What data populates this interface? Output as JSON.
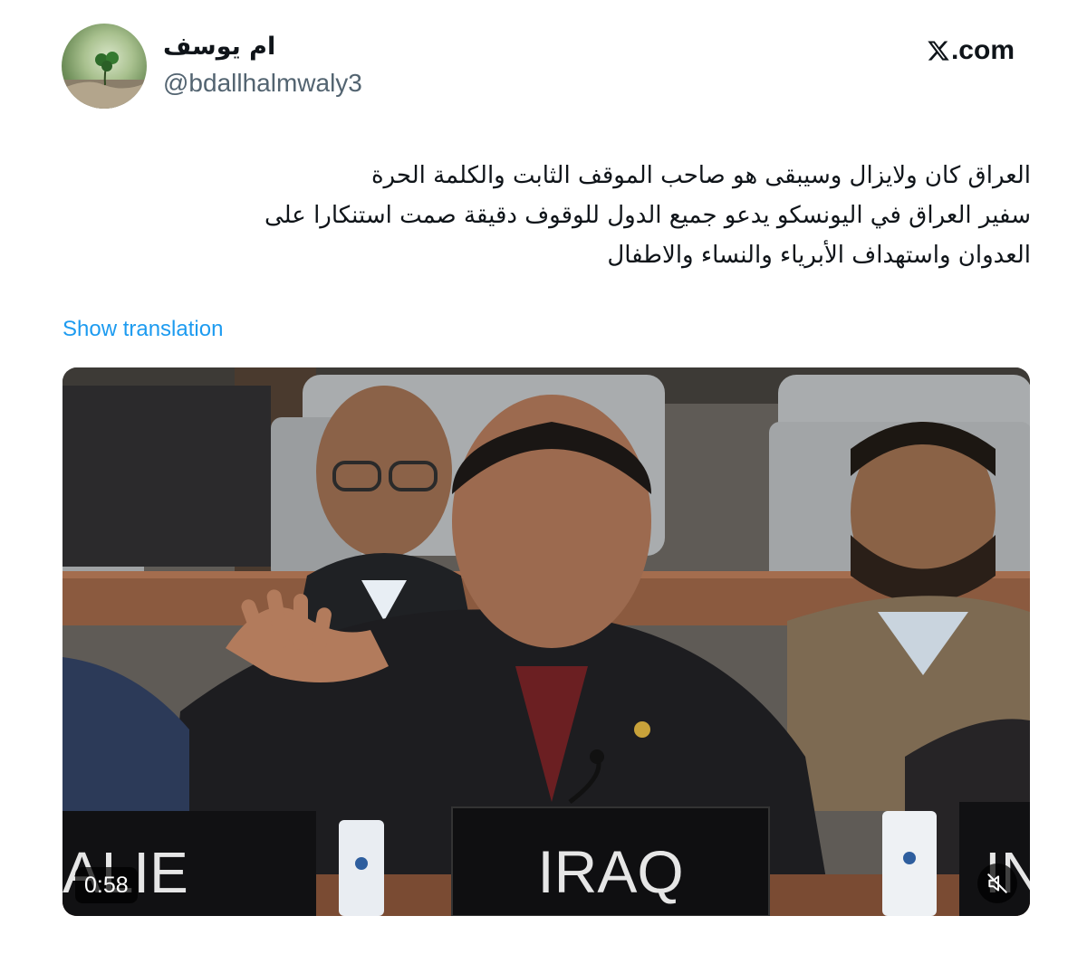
{
  "author": {
    "display_name": "ام يوسف",
    "handle": "@bdallhalmwaly3",
    "avatar_icon": "clover-leaf-avatar"
  },
  "brand": {
    "logo_icon": "x-logo-icon",
    "text": ".com"
  },
  "tweet": {
    "lines": [
      "العراق كان ولايزال وسيبقى هو صاحب الموقف الثابت والكلمة الحرة",
      "سفير العراق في اليونسكو يدعو جميع الدول للوقوف دقيقة صمت استنكارا على",
      "العدوان واستهداف الأبرياء والنساء والاطفال"
    ],
    "translate_label": "Show translation"
  },
  "media": {
    "type": "video",
    "duration": "0:58",
    "nameplates": [
      "ALIE",
      "IRAQ",
      "IN"
    ],
    "mute_icon": "speaker-muted-icon"
  },
  "colors": {
    "link": "#1d9bf0",
    "secondary_text": "#536471",
    "primary_text": "#0f1419"
  }
}
